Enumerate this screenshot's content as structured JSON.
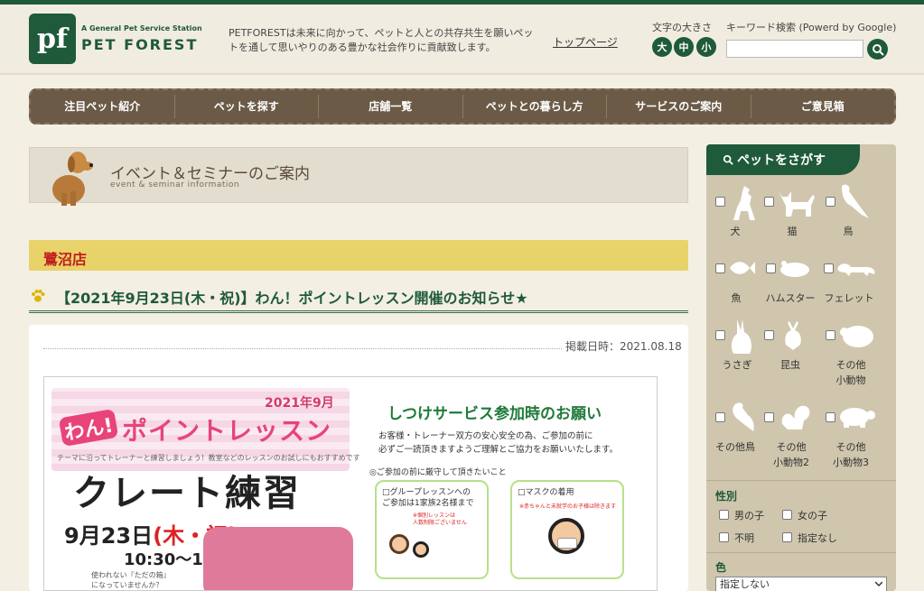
{
  "header": {
    "logo_small": "A General Pet Service Station",
    "logo_name": "PET FOREST",
    "logo_mark": "pf",
    "tagline": "PETFORESTは未来に向かって、ペットと人との共存共生を願いペットを通して思いやりのある豊かな社会作りに貢献致します。",
    "top_link": "トップページ",
    "font_size_label": "文字の大きさ",
    "font_sizes": [
      "大",
      "中",
      "小"
    ],
    "search_label": "キーワード検索 (Powerd by Google)",
    "search_value": ""
  },
  "nav": [
    "注目ペット紹介",
    "ペットを探す",
    "店舗一覧",
    "ペットとの暮らし方",
    "サービスのご案内",
    "ご意見箱"
  ],
  "page": {
    "title": "イベント＆セミナーのご案内",
    "subtitle": "event & seminar information",
    "store": "鷺沼店",
    "post_title": "【2021年9月23日(木・祝)】わん！ポイントレッスン開催のお知らせ★",
    "post_date": "掲載日時：2021.08.18"
  },
  "flyer": {
    "year": "2021年9月",
    "wan": "わん!",
    "point_lesson": "ポイントレッスン",
    "note": "テーマに沿ってトレーナーと練習しましょう！教室などのレッスンのお試しにもおすすめです",
    "crate": "クレート練習",
    "date_prefix": "9月23日",
    "date_day": "(木・祝)",
    "time": "10:30～11:30",
    "question_1": "使われない『ただの箱』",
    "question_2": "になっていませんか？",
    "right_title": "しつけサービス参加時のお願い",
    "right_text_1": "お客様・トレーナー双方の安心安全の為、ご参加の前に",
    "right_text_2": "必ずご一読頂きますようご理解とご協力をお願いいたします。",
    "right_sub": "◎ご参加の前に厳守して頂きたいこと",
    "card1_title_1": "□グループレッスンへの",
    "card1_title_2": "ご参加は1家族2名様まで",
    "card1_note_1": "※個別レッスンは",
    "card1_note_2": "人数制限ございません",
    "card2_title": "□マスクの着用",
    "card2_note": "※赤ちゃんと未就学のお子様は除きます"
  },
  "sidebar": {
    "heading": "ペットをさがす",
    "pets": [
      {
        "label": "犬",
        "icon": "dog-icon"
      },
      {
        "label": "猫",
        "icon": "cat-icon"
      },
      {
        "label": "鳥",
        "icon": "bird-icon"
      },
      {
        "label": "魚",
        "icon": "fish-icon"
      },
      {
        "label": "ハムスター",
        "icon": "hamster-icon"
      },
      {
        "label": "フェレット",
        "icon": "ferret-icon"
      },
      {
        "label": "うさぎ",
        "icon": "rabbit-icon"
      },
      {
        "label": "昆虫",
        "icon": "beetle-icon"
      },
      {
        "label": "その他小動物",
        "label_1": "その他",
        "label_2": "小動物",
        "icon": "small-animal-icon"
      },
      {
        "label": "その他鳥",
        "icon": "other-bird-icon"
      },
      {
        "label": "その他小動物2",
        "label_1": "その他",
        "label_2": "小動物2",
        "icon": "squirrel-icon"
      },
      {
        "label": "その他小動物3",
        "label_1": "その他",
        "label_2": "小動物3",
        "icon": "turtle-icon"
      }
    ],
    "gender_label": "性別",
    "gender_options": [
      "男の子",
      "女の子",
      "不明",
      "指定なし"
    ],
    "color_label": "色",
    "color_value": "指定しない"
  },
  "colors": {
    "brand_green": "#1f5a3a",
    "nav_brown": "#6b5a46",
    "store_yellow": "#e8d36a",
    "store_red": "#c21f1f",
    "sidebar_tan": "#cfc6ad"
  }
}
